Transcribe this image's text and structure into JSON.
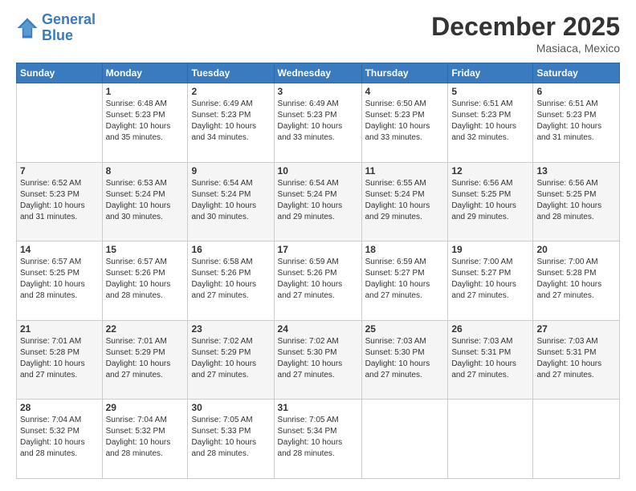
{
  "header": {
    "logo_line1": "General",
    "logo_line2": "Blue",
    "month": "December 2025",
    "location": "Masiaca, Mexico"
  },
  "weekdays": [
    "Sunday",
    "Monday",
    "Tuesday",
    "Wednesday",
    "Thursday",
    "Friday",
    "Saturday"
  ],
  "weeks": [
    [
      {
        "num": "",
        "info": ""
      },
      {
        "num": "1",
        "info": "Sunrise: 6:48 AM\nSunset: 5:23 PM\nDaylight: 10 hours\nand 35 minutes."
      },
      {
        "num": "2",
        "info": "Sunrise: 6:49 AM\nSunset: 5:23 PM\nDaylight: 10 hours\nand 34 minutes."
      },
      {
        "num": "3",
        "info": "Sunrise: 6:49 AM\nSunset: 5:23 PM\nDaylight: 10 hours\nand 33 minutes."
      },
      {
        "num": "4",
        "info": "Sunrise: 6:50 AM\nSunset: 5:23 PM\nDaylight: 10 hours\nand 33 minutes."
      },
      {
        "num": "5",
        "info": "Sunrise: 6:51 AM\nSunset: 5:23 PM\nDaylight: 10 hours\nand 32 minutes."
      },
      {
        "num": "6",
        "info": "Sunrise: 6:51 AM\nSunset: 5:23 PM\nDaylight: 10 hours\nand 31 minutes."
      }
    ],
    [
      {
        "num": "7",
        "info": "Sunrise: 6:52 AM\nSunset: 5:23 PM\nDaylight: 10 hours\nand 31 minutes."
      },
      {
        "num": "8",
        "info": "Sunrise: 6:53 AM\nSunset: 5:24 PM\nDaylight: 10 hours\nand 30 minutes."
      },
      {
        "num": "9",
        "info": "Sunrise: 6:54 AM\nSunset: 5:24 PM\nDaylight: 10 hours\nand 30 minutes."
      },
      {
        "num": "10",
        "info": "Sunrise: 6:54 AM\nSunset: 5:24 PM\nDaylight: 10 hours\nand 29 minutes."
      },
      {
        "num": "11",
        "info": "Sunrise: 6:55 AM\nSunset: 5:24 PM\nDaylight: 10 hours\nand 29 minutes."
      },
      {
        "num": "12",
        "info": "Sunrise: 6:56 AM\nSunset: 5:25 PM\nDaylight: 10 hours\nand 29 minutes."
      },
      {
        "num": "13",
        "info": "Sunrise: 6:56 AM\nSunset: 5:25 PM\nDaylight: 10 hours\nand 28 minutes."
      }
    ],
    [
      {
        "num": "14",
        "info": "Sunrise: 6:57 AM\nSunset: 5:25 PM\nDaylight: 10 hours\nand 28 minutes."
      },
      {
        "num": "15",
        "info": "Sunrise: 6:57 AM\nSunset: 5:26 PM\nDaylight: 10 hours\nand 28 minutes."
      },
      {
        "num": "16",
        "info": "Sunrise: 6:58 AM\nSunset: 5:26 PM\nDaylight: 10 hours\nand 27 minutes."
      },
      {
        "num": "17",
        "info": "Sunrise: 6:59 AM\nSunset: 5:26 PM\nDaylight: 10 hours\nand 27 minutes."
      },
      {
        "num": "18",
        "info": "Sunrise: 6:59 AM\nSunset: 5:27 PM\nDaylight: 10 hours\nand 27 minutes."
      },
      {
        "num": "19",
        "info": "Sunrise: 7:00 AM\nSunset: 5:27 PM\nDaylight: 10 hours\nand 27 minutes."
      },
      {
        "num": "20",
        "info": "Sunrise: 7:00 AM\nSunset: 5:28 PM\nDaylight: 10 hours\nand 27 minutes."
      }
    ],
    [
      {
        "num": "21",
        "info": "Sunrise: 7:01 AM\nSunset: 5:28 PM\nDaylight: 10 hours\nand 27 minutes."
      },
      {
        "num": "22",
        "info": "Sunrise: 7:01 AM\nSunset: 5:29 PM\nDaylight: 10 hours\nand 27 minutes."
      },
      {
        "num": "23",
        "info": "Sunrise: 7:02 AM\nSunset: 5:29 PM\nDaylight: 10 hours\nand 27 minutes."
      },
      {
        "num": "24",
        "info": "Sunrise: 7:02 AM\nSunset: 5:30 PM\nDaylight: 10 hours\nand 27 minutes."
      },
      {
        "num": "25",
        "info": "Sunrise: 7:03 AM\nSunset: 5:30 PM\nDaylight: 10 hours\nand 27 minutes."
      },
      {
        "num": "26",
        "info": "Sunrise: 7:03 AM\nSunset: 5:31 PM\nDaylight: 10 hours\nand 27 minutes."
      },
      {
        "num": "27",
        "info": "Sunrise: 7:03 AM\nSunset: 5:31 PM\nDaylight: 10 hours\nand 27 minutes."
      }
    ],
    [
      {
        "num": "28",
        "info": "Sunrise: 7:04 AM\nSunset: 5:32 PM\nDaylight: 10 hours\nand 28 minutes."
      },
      {
        "num": "29",
        "info": "Sunrise: 7:04 AM\nSunset: 5:32 PM\nDaylight: 10 hours\nand 28 minutes."
      },
      {
        "num": "30",
        "info": "Sunrise: 7:05 AM\nSunset: 5:33 PM\nDaylight: 10 hours\nand 28 minutes."
      },
      {
        "num": "31",
        "info": "Sunrise: 7:05 AM\nSunset: 5:34 PM\nDaylight: 10 hours\nand 28 minutes."
      },
      {
        "num": "",
        "info": ""
      },
      {
        "num": "",
        "info": ""
      },
      {
        "num": "",
        "info": ""
      }
    ]
  ]
}
